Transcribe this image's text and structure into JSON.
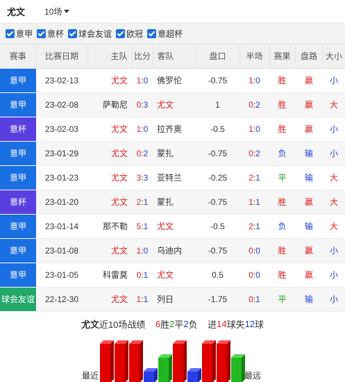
{
  "header": {
    "team": "尤文",
    "match_count": "10场"
  },
  "filters": [
    {
      "label": "意甲",
      "checked": true
    },
    {
      "label": "意杯",
      "checked": true
    },
    {
      "label": "球会友谊",
      "checked": true
    },
    {
      "label": "欧冠",
      "checked": true
    },
    {
      "label": "意超杯",
      "checked": true
    }
  ],
  "columns": [
    "赛事",
    "比赛日期",
    "主队",
    "比分",
    "客队",
    "盘口",
    "半场",
    "赛果",
    "盘路",
    "大小"
  ],
  "colors": {
    "serie_a": "#1a6fe3",
    "coppa": "#5b3ee0",
    "friendly": "#22a86a",
    "win": "#e02020",
    "draw": "#1a9a1a",
    "loss": "#1f3fd6"
  },
  "matches": [
    {
      "league": "意甲",
      "date": "23-02-13",
      "home": "尤文",
      "score": [
        "1",
        ":",
        "0"
      ],
      "away": "佛罗伦",
      "handicap": "-0.75",
      "half": [
        "1",
        ":",
        "0"
      ],
      "result": "胜",
      "ah": "赢",
      "ou": "小"
    },
    {
      "league": "意甲",
      "date": "23-02-08",
      "home": "萨勒尼",
      "score": [
        "0",
        ":",
        "3"
      ],
      "away": "尤文",
      "handicap": "1",
      "half": [
        "0",
        ":",
        "2"
      ],
      "result": "胜",
      "ah": "赢",
      "ou": "大"
    },
    {
      "league": "意杯",
      "date": "23-02-03",
      "home": "尤文",
      "score": [
        "1",
        ":",
        "0"
      ],
      "away": "拉齐奥",
      "handicap": "-0.5",
      "half": [
        "1",
        ":",
        "0"
      ],
      "result": "胜",
      "ah": "赢",
      "ou": "小"
    },
    {
      "league": "意甲",
      "date": "23-01-29",
      "home": "尤文",
      "score": [
        "0",
        ":",
        "2"
      ],
      "away": "蒙扎",
      "handicap": "-0.75",
      "half": [
        "0",
        ":",
        "2"
      ],
      "result": "负",
      "ah": "输",
      "ou": "小"
    },
    {
      "league": "意甲",
      "date": "23-01-23",
      "home": "尤文",
      "score": [
        "3",
        ":",
        "3"
      ],
      "away": "亚特兰",
      "handicap": "-0.25",
      "half": [
        "2",
        ":",
        "1"
      ],
      "result": "平",
      "ah": "输",
      "ou": "大"
    },
    {
      "league": "意杯",
      "date": "23-01-20",
      "home": "尤文",
      "score": [
        "2",
        ":",
        "1"
      ],
      "away": "蒙扎",
      "handicap": "-0.75",
      "half": [
        "1",
        ":",
        "1"
      ],
      "result": "胜",
      "ah": "赢",
      "ou": "大"
    },
    {
      "league": "意甲",
      "date": "23-01-14",
      "home": "那不勒",
      "score": [
        "5",
        ":",
        "1"
      ],
      "away": "尤文",
      "handicap": "-0.5",
      "half": [
        "2",
        ":",
        "1"
      ],
      "result": "负",
      "ah": "输",
      "ou": "大"
    },
    {
      "league": "意甲",
      "date": "23-01-08",
      "home": "尤文",
      "score": [
        "1",
        ":",
        "0"
      ],
      "away": "乌迪内",
      "handicap": "-0.75",
      "half": [
        "0",
        ":",
        "0"
      ],
      "result": "胜",
      "ah": "赢",
      "ou": "小"
    },
    {
      "league": "意甲",
      "date": "23-01-05",
      "home": "科雷莫",
      "score": [
        "0",
        ":",
        "1"
      ],
      "away": "尤文",
      "handicap": "0.5",
      "half": [
        "0",
        ":",
        "0"
      ],
      "result": "胜",
      "ah": "赢",
      "ou": "小"
    },
    {
      "league": "球会友谊",
      "date": "22-12-30",
      "home": "尤文",
      "score": [
        "1",
        ":",
        "1"
      ],
      "away": "列日",
      "handicap": "-1.75",
      "half": [
        "0",
        ":",
        "1"
      ],
      "result": "平",
      "ah": "输",
      "ou": "小"
    }
  ],
  "summary": {
    "team": "尤文",
    "text1": "近10场战绩",
    "wins": "6",
    "win_label": "胜",
    "draws": "2",
    "draw_label": "平",
    "losses": "2",
    "loss_label": "负",
    "scored_prefix": "进",
    "scored": "14",
    "scored_label": "球失",
    "conceded": "12",
    "conceded_label": "球"
  },
  "form_chart": {
    "near_label": "最近",
    "far_label": "最远",
    "results": [
      "胜",
      "胜",
      "胜",
      "负",
      "平",
      "胜",
      "负",
      "胜",
      "胜",
      "平"
    ]
  }
}
